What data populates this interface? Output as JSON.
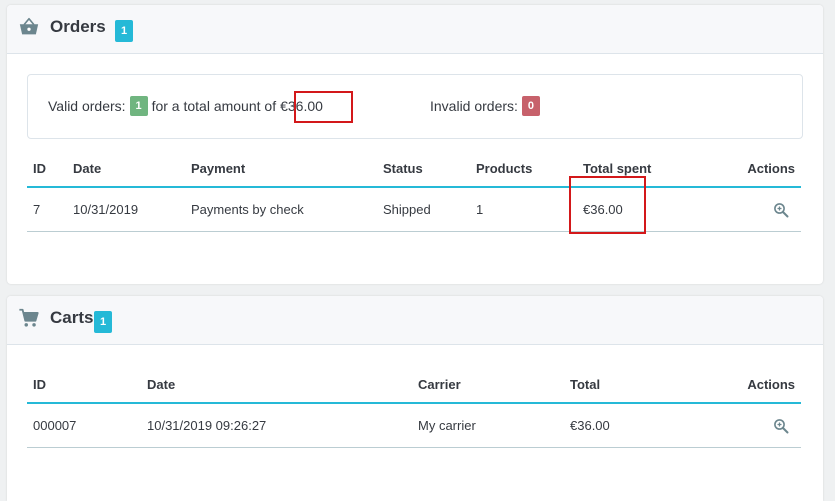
{
  "orders": {
    "title": "Orders",
    "count": "1",
    "summary": {
      "valid_label": "Valid orders:",
      "valid_count": "1",
      "total_label": "for a total amount of",
      "total_amount": "€36.00",
      "invalid_label": "Invalid orders:",
      "invalid_count": "0"
    },
    "columns": [
      "ID",
      "Date",
      "Payment",
      "Status",
      "Products",
      "Total spent",
      "Actions"
    ],
    "rows": [
      {
        "id": "7",
        "date": "10/31/2019",
        "payment": "Payments by check",
        "status": "Shipped",
        "products": "1",
        "total": "€36.00"
      }
    ]
  },
  "carts": {
    "title": "Carts",
    "count": "1",
    "columns": [
      "ID",
      "Date",
      "Carrier",
      "Total",
      "Actions"
    ],
    "rows": [
      {
        "id": "000007",
        "date": "10/31/2019 09:26:27",
        "carrier": "My carrier",
        "total": "€36.00"
      }
    ]
  },
  "colors": {
    "accent": "#25b9d7",
    "success": "#70b580",
    "danger": "#c7616b",
    "highlight": "#d3181a"
  },
  "icons": {
    "orders": "basket-icon",
    "carts": "shopping-cart-icon",
    "view": "magnifier-plus-icon"
  }
}
